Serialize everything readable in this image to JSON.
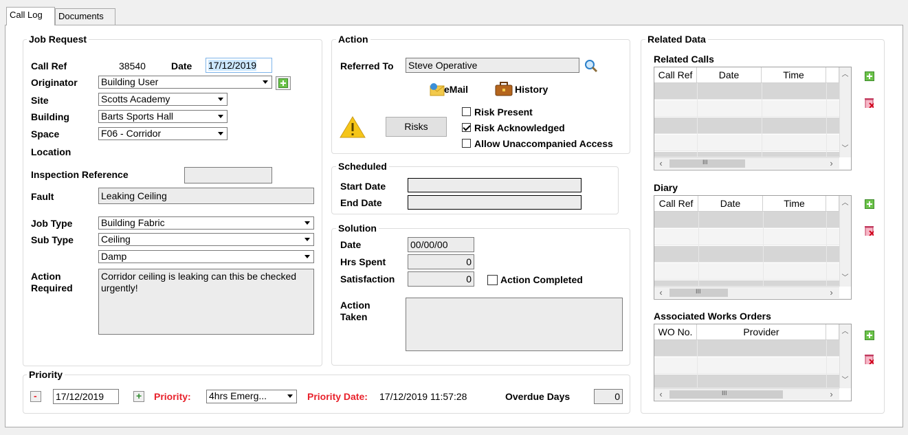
{
  "tabs": [
    "Call Log",
    "Documents"
  ],
  "job_request": {
    "title": "Job Request",
    "call_ref_label": "Call Ref",
    "call_ref": "38540",
    "date_label": "Date",
    "date": "17/12/2019",
    "originator_label": "Originator",
    "originator": "Building User",
    "site_label": "Site",
    "site": "Scotts Academy",
    "building_label": "Building",
    "building": "Barts Sports Hall",
    "space_label": "Space",
    "space": "F06 - Corridor",
    "location_label": "Location",
    "inspection_label": "Inspection Reference",
    "inspection": "",
    "fault_label": "Fault",
    "fault": "Leaking Ceiling",
    "job_type_label": "Job Type",
    "job_type": "Building Fabric",
    "sub_type_label": "Sub Type",
    "sub_type": "Ceiling",
    "sub_type2": "Damp",
    "action_required_label1": "Action",
    "action_required_label2": "Required",
    "action_required_line1": "Corridor ceiling is leaking can this be checked",
    "action_required_line2": "urgently!"
  },
  "action": {
    "title": "Action",
    "referred_to_label": "Referred To",
    "referred_to": "Steve Operative",
    "email_label": "eMail",
    "history_label": "History",
    "risks_button": "Risks",
    "risk_present": "Risk Present",
    "risk_present_checked": false,
    "risk_ack": "Risk Acknowledged",
    "risk_ack_checked": true,
    "unaccompanied": "Allow Unaccompanied Access",
    "unaccompanied_checked": false
  },
  "scheduled": {
    "title": "Scheduled",
    "start_label": "Start Date",
    "start": "",
    "end_label": "End Date",
    "end": ""
  },
  "solution": {
    "title": "Solution",
    "date_label": "Date",
    "date": "00/00/00",
    "hrs_label": "Hrs Spent",
    "hrs": "0",
    "satisfaction_label": "Satisfaction",
    "satisfaction": "0",
    "action_completed": "Action Completed",
    "action_completed_checked": false,
    "action_taken_label1": "Action",
    "action_taken_label2": "Taken",
    "action_taken": ""
  },
  "priority": {
    "title": "Priority",
    "minus": "-",
    "date": "17/12/2019",
    "plus": "+",
    "priority_label": "Priority:",
    "priority": "4hrs Emerg...",
    "priority_date_label": "Priority Date:",
    "priority_date": "17/12/2019 11:57:28",
    "overdue_label": "Overdue Days",
    "overdue": "0"
  },
  "related": {
    "title": "Related Data",
    "calls_title": "Related Calls",
    "calls_headers": [
      "Call Ref",
      "Date",
      "Time"
    ],
    "diary_title": "Diary",
    "diary_headers": [
      "Call Ref",
      "Date",
      "Time"
    ],
    "wo_title": "Associated Works Orders",
    "wo_headers": [
      "WO No.",
      "Provider"
    ],
    "scroll_thumb_glyph": "III"
  },
  "colors": {
    "accent_red": "#e8212b",
    "add_green": "#6cc24a"
  }
}
